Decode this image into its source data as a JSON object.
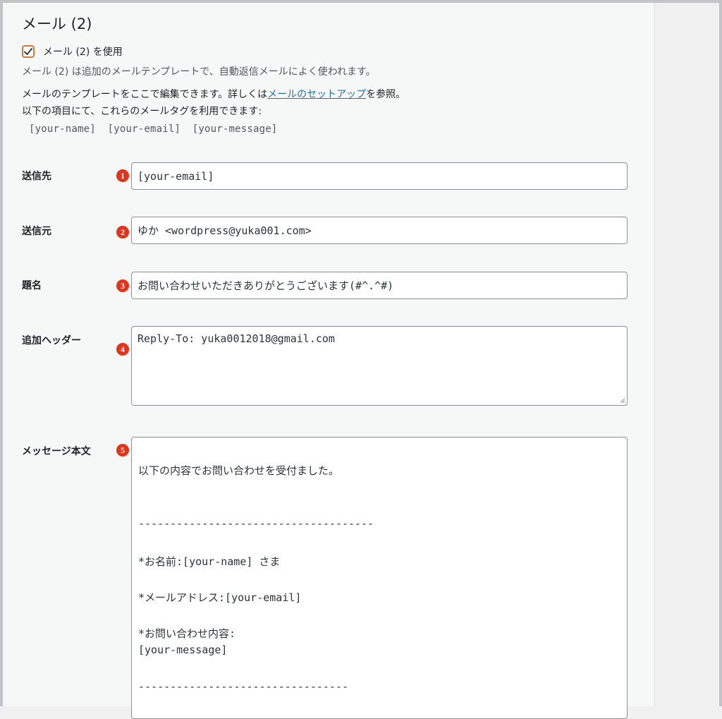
{
  "section": {
    "title": "メール (2)",
    "use_checkbox_label": "メール (2) を使用",
    "description": "メール (2) は追加のメールテンプレートで、自動返信メールによく使われます。",
    "template_note_before": "メールのテンプレートをここで編集できます。詳しくは",
    "template_note_link": "メールのセットアップ",
    "template_note_after": "を参照。",
    "tags_note": "以下の項目にて、これらのメールタグを利用できます:",
    "tags": [
      "[your-name]",
      "[your-email]",
      "[your-message]"
    ]
  },
  "fields": {
    "to": {
      "label": "送信先",
      "badge": "❶",
      "value": "[your-email]"
    },
    "from": {
      "label": "送信元",
      "badge": "❷",
      "value": "ゆか <wordpress@yuka001.com>"
    },
    "subject": {
      "label": "題名",
      "badge": "❸",
      "value": "お問い合わせいただきありがとうございます(#^.^#)"
    },
    "headers": {
      "label": "追加ヘッダー",
      "badge": "❹",
      "value": "Reply-To: yuka0012018@gmail.com"
    },
    "body": {
      "label": "メッセージ本文",
      "badge": "❺",
      "lines": [
        "以下の内容でお問い合わせを受付ました。",
        "-------------------------------------",
        "*お名前:[your-name] さま",
        "*メールアドレス:[your-email]",
        "*お問い合わせ内容:",
        "[your-message]",
        "---------------------------------"
      ]
    }
  },
  "colors": {
    "badge": "#e0341b",
    "checkbox_border": "#d67835",
    "link": "#2271b1"
  }
}
